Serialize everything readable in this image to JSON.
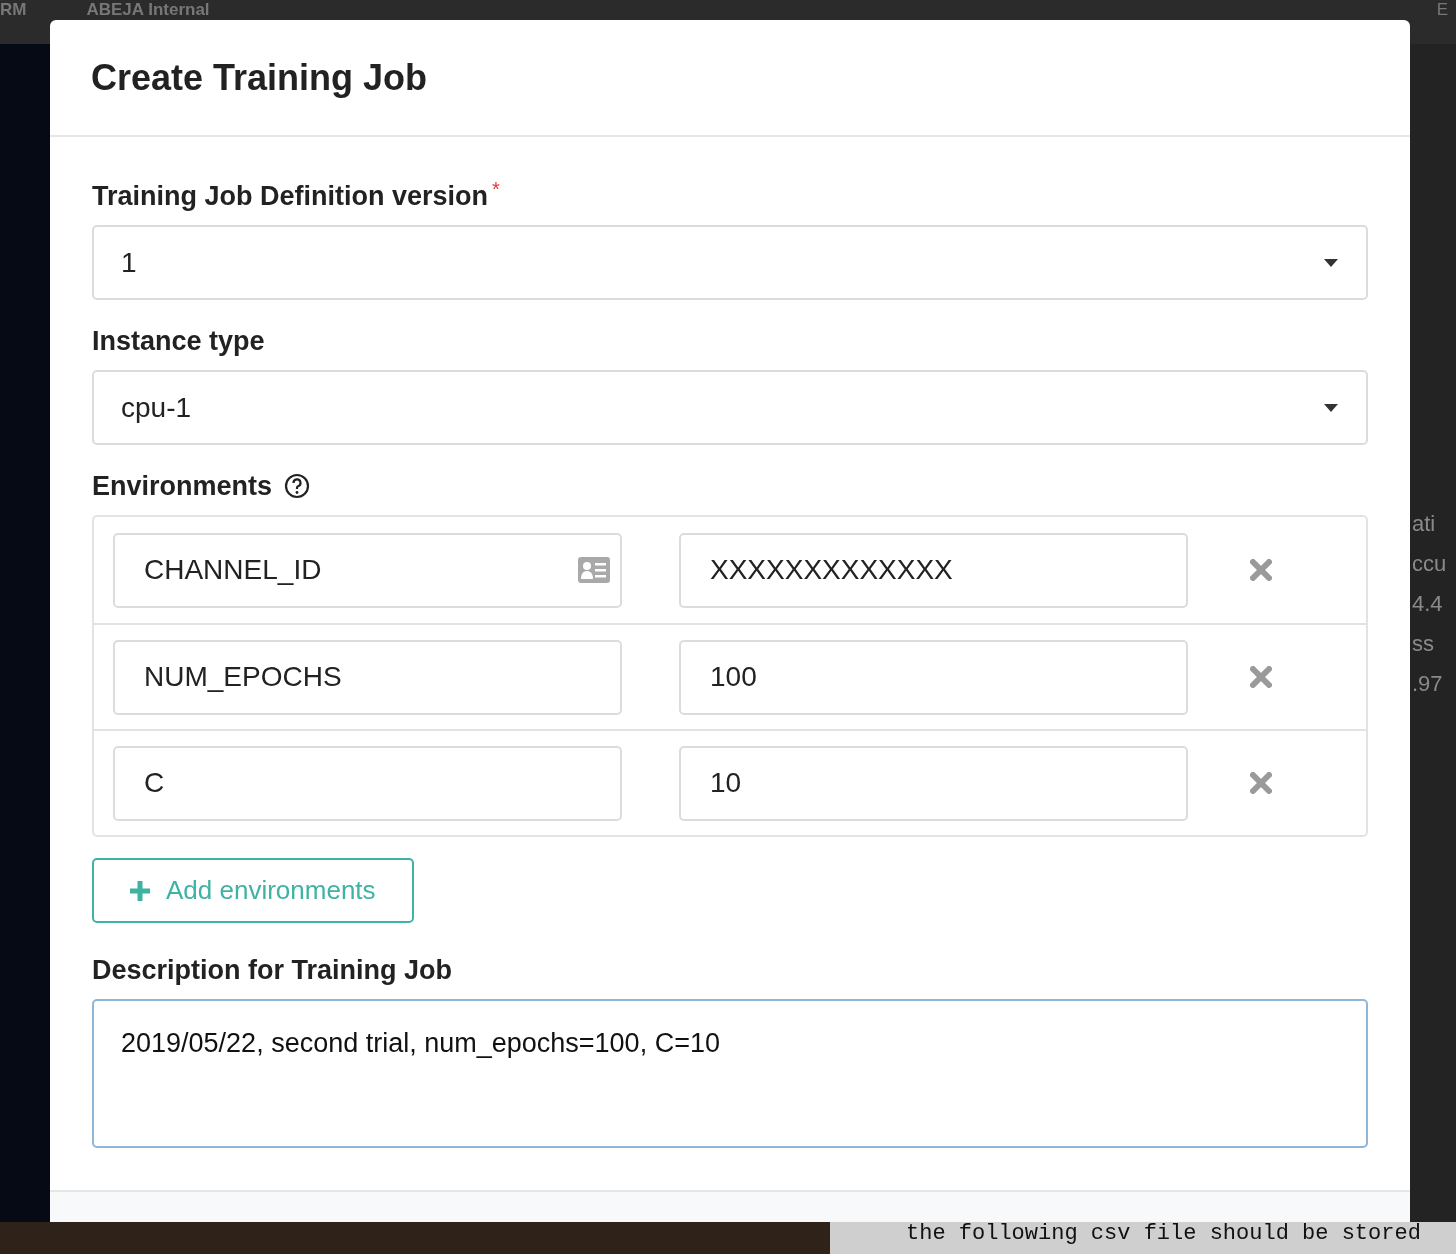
{
  "background": {
    "top_bar": {
      "brand": "RM",
      "org": "ABEJA Internal",
      "user": "E"
    },
    "side_texts": [
      "ati",
      "ccu",
      "4.4",
      "ss",
      ".97"
    ],
    "bottom_text": "the following csv file should be stored"
  },
  "dialog": {
    "title": "Create Training Job",
    "version": {
      "label": "Training Job Definition version",
      "required_mark": "*",
      "value": "1"
    },
    "instance": {
      "label": "Instance type",
      "value": "cpu-1"
    },
    "environments": {
      "label": "Environments",
      "rows": [
        {
          "key": "CHANNEL_ID",
          "value": "XXXXXXXXXXXXX",
          "autofill": true
        },
        {
          "key": "NUM_EPOCHS",
          "value": "100",
          "autofill": false
        },
        {
          "key": "C",
          "value": "10",
          "autofill": false
        }
      ],
      "add_button": "Add environments"
    },
    "description": {
      "label": "Description for Training Job",
      "value": "2019/05/22, second trial, num_epochs=100, C=10",
      "focused": true
    }
  }
}
